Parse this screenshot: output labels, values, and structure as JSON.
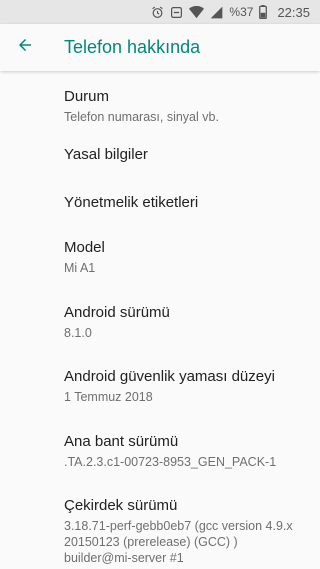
{
  "status_bar": {
    "battery_percent": "%37",
    "time": "22:35"
  },
  "app_bar": {
    "title": "Telefon hakkında",
    "accent_color": "#00897b"
  },
  "items": [
    {
      "title": "Durum",
      "subtitle": "Telefon numarası, sinyal vb."
    },
    {
      "title": "Yasal bilgiler"
    },
    {
      "title": "Yönetmelik etiketleri"
    },
    {
      "title": "Model",
      "subtitle": "Mi A1"
    },
    {
      "title": "Android sürümü",
      "subtitle": "8.1.0"
    },
    {
      "title": "Android güvenlik yaması düzeyi",
      "subtitle": "1 Temmuz 2018"
    },
    {
      "title": "Ana bant sürümü",
      "subtitle": ".TA.2.3.c1-00723-8953_GEN_PACK-1"
    },
    {
      "title": "Çekirdek sürümü",
      "subtitle_lines": [
        "3.18.71-perf-gebb0eb7 (gcc version 4.9.x",
        "20150123 (prerelease) (GCC) )",
        "builder@mi-server #1"
      ]
    }
  ]
}
